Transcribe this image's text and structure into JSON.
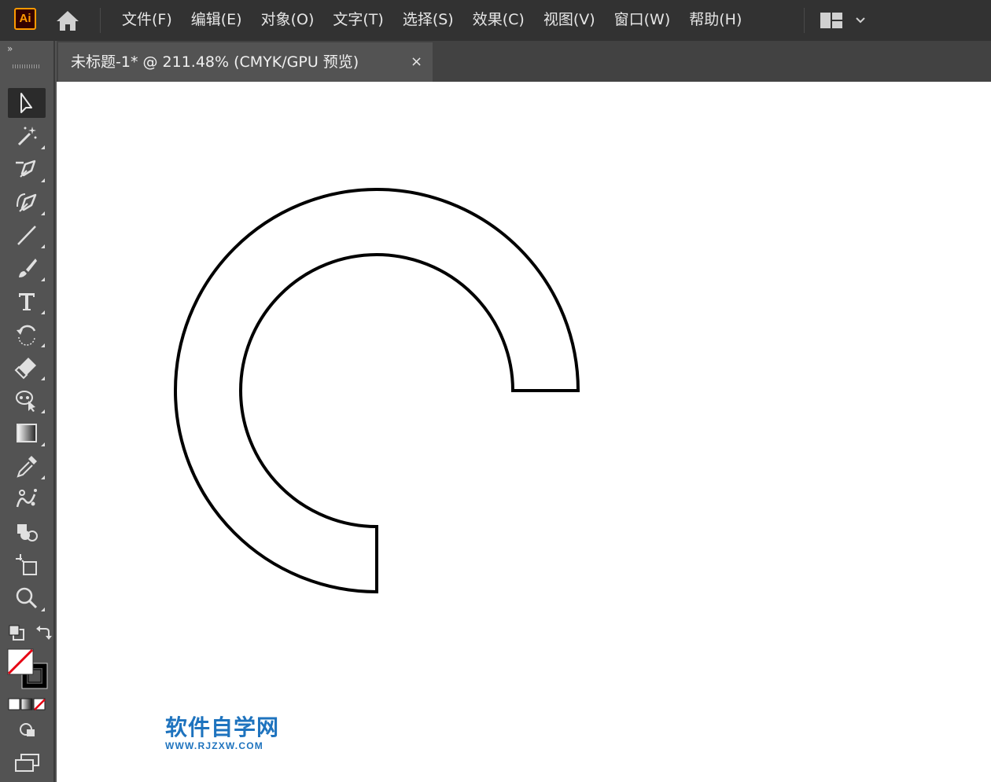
{
  "app": {
    "logo_text": "Ai"
  },
  "menu": {
    "items": [
      {
        "id": "file",
        "label": "文件(F)"
      },
      {
        "id": "edit",
        "label": "编辑(E)"
      },
      {
        "id": "object",
        "label": "对象(O)"
      },
      {
        "id": "type",
        "label": "文字(T)"
      },
      {
        "id": "select",
        "label": "选择(S)"
      },
      {
        "id": "effect",
        "label": "效果(C)"
      },
      {
        "id": "view",
        "label": "视图(V)"
      },
      {
        "id": "window",
        "label": "窗口(W)"
      },
      {
        "id": "help",
        "label": "帮助(H)"
      }
    ]
  },
  "toolbar": {
    "collapse_glyph": "»",
    "tools": [
      {
        "id": "selection",
        "icon": "selection-arrow-icon",
        "active": true,
        "has_submenu": false
      },
      {
        "id": "magic-wand",
        "icon": "magic-wand-icon",
        "active": false,
        "has_submenu": true
      },
      {
        "id": "pen",
        "icon": "pen-icon",
        "active": false,
        "has_submenu": true
      },
      {
        "id": "curvature",
        "icon": "curvature-pen-icon",
        "active": false,
        "has_submenu": true
      },
      {
        "id": "line",
        "icon": "line-segment-icon",
        "active": false,
        "has_submenu": true
      },
      {
        "id": "paintbrush",
        "icon": "paintbrush-icon",
        "active": false,
        "has_submenu": true
      },
      {
        "id": "type",
        "icon": "type-icon",
        "active": false,
        "has_submenu": true
      },
      {
        "id": "rotate",
        "icon": "rotate-icon",
        "active": false,
        "has_submenu": true
      },
      {
        "id": "eraser",
        "icon": "eraser-icon",
        "active": false,
        "has_submenu": true
      },
      {
        "id": "puppet-warp",
        "icon": "puppet-warp-icon",
        "active": false,
        "has_submenu": true
      },
      {
        "id": "gradient",
        "icon": "gradient-icon",
        "active": false,
        "has_submenu": true
      },
      {
        "id": "eyedropper",
        "icon": "eyedropper-icon",
        "active": false,
        "has_submenu": true
      },
      {
        "id": "symbol-sprayer",
        "icon": "symbol-sprayer-icon",
        "active": false,
        "has_submenu": false
      },
      {
        "id": "shape-builder",
        "icon": "shape-builder-icon",
        "active": false,
        "has_submenu": false
      },
      {
        "id": "artboard",
        "icon": "artboard-icon",
        "active": false,
        "has_submenu": false
      },
      {
        "id": "zoom",
        "icon": "zoom-icon",
        "active": false,
        "has_submenu": true
      }
    ],
    "fill": "none",
    "stroke": "#000000"
  },
  "document_tab": {
    "title": "未标题-1*  @  211.48%  (CMYK/GPU 预览)",
    "close_glyph": "×"
  },
  "artwork": {
    "shape": "ring-arc",
    "stroke_color": "#000000",
    "fill_color": "#ffffff"
  },
  "watermark": {
    "name": "软件自学网",
    "url": "WWW.RJZXW.COM",
    "color": "#1e73be"
  }
}
